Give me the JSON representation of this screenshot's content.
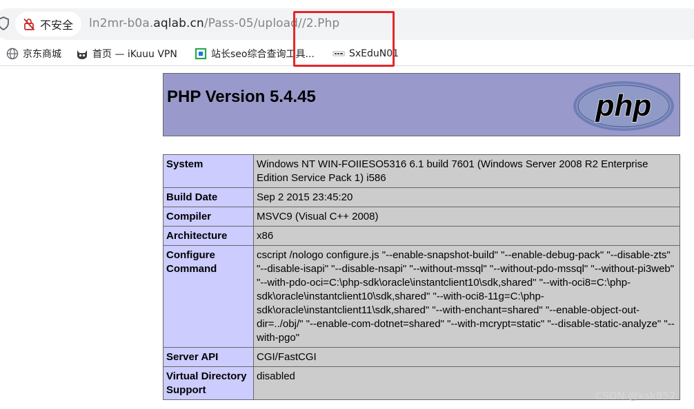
{
  "address_bar": {
    "security_label": "不安全",
    "url_prefix": "ln2mr-b0a.",
    "url_host": "aqlab.cn",
    "url_path": "/Pass-05/upload/",
    "url_file": "/2.Php"
  },
  "bookmarks": [
    {
      "label": "京东商城",
      "icon": "globe-icon"
    },
    {
      "label": "首页 — iKuuu VPN",
      "icon": "cat-icon"
    },
    {
      "label": "站长seo综合查询工具...",
      "icon": "seo-icon"
    },
    {
      "label": "SxEduN01",
      "icon": "site-icon"
    }
  ],
  "phpinfo": {
    "title": "PHP Version 5.4.45",
    "logo_text": "php",
    "rows": [
      {
        "key": "System",
        "value": "Windows NT WIN-FOIIESO5316 6.1 build 7601 (Windows Server 2008 R2 Enterprise Edition Service Pack 1) i586"
      },
      {
        "key": "Build Date",
        "value": "Sep 2 2015 23:45:20"
      },
      {
        "key": "Compiler",
        "value": "MSVC9 (Visual C++ 2008)"
      },
      {
        "key": "Architecture",
        "value": "x86"
      },
      {
        "key": "Configure Command",
        "value": "cscript /nologo configure.js \"--enable-snapshot-build\" \"--enable-debug-pack\" \"--disable-zts\" \"--disable-isapi\" \"--disable-nsapi\" \"--without-mssql\" \"--without-pdo-mssql\" \"--without-pi3web\" \"--with-pdo-oci=C:\\php-sdk\\oracle\\instantclient10\\sdk,shared\" \"--with-oci8=C:\\php-sdk\\oracle\\instantclient10\\sdk,shared\" \"--with-oci8-11g=C:\\php-sdk\\oracle\\instantclient11\\sdk,shared\" \"--with-enchant=shared\" \"--enable-object-out-dir=../obj/\" \"--enable-com-dotnet=shared\" \"--with-mcrypt=static\" \"--disable-static-analyze\" \"--with-pgo\""
      },
      {
        "key": "Server API",
        "value": "CGI/FastCGI"
      },
      {
        "key": "Virtual Directory Support",
        "value": "disabled"
      }
    ]
  },
  "watermark": "CSDN @ksk852",
  "colors": {
    "banner": "#9999cc",
    "key_cell": "#ccccff",
    "value_cell": "#cccccc",
    "highlight": "#e5262a"
  }
}
